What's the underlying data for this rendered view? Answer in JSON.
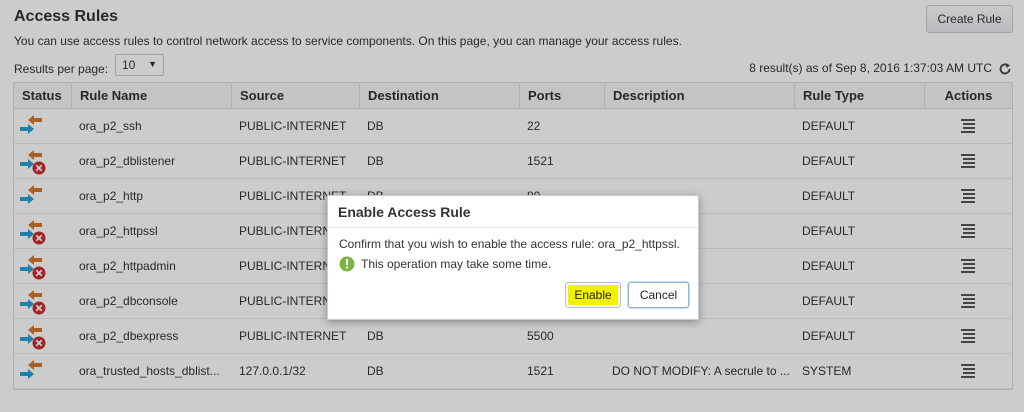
{
  "page": {
    "title": "Access Rules",
    "subtitle": "You can use access rules to control network access to service components. On this page, you can manage your access rules.",
    "create_button": "Create Rule"
  },
  "toolbar": {
    "results_per_page_label": "Results per page:",
    "results_per_page_value": "10",
    "results_info": "8 result(s) as of Sep 8, 2016 1:37:03 AM UTC"
  },
  "table": {
    "columns": [
      "Status",
      "Rule Name",
      "Source",
      "Destination",
      "Ports",
      "Description",
      "Rule Type",
      "Actions"
    ],
    "rows": [
      {
        "status": "enabled",
        "name": "ora_p2_ssh",
        "source": "PUBLIC-INTERNET",
        "destination": "DB",
        "ports": "22",
        "description": "",
        "type": "DEFAULT"
      },
      {
        "status": "disabled",
        "name": "ora_p2_dblistener",
        "source": "PUBLIC-INTERNET",
        "destination": "DB",
        "ports": "1521",
        "description": "",
        "type": "DEFAULT"
      },
      {
        "status": "enabled",
        "name": "ora_p2_http",
        "source": "PUBLIC-INTERNET",
        "destination": "DB",
        "ports": "80",
        "description": "",
        "type": "DEFAULT"
      },
      {
        "status": "disabled",
        "name": "ora_p2_httpssl",
        "source": "PUBLIC-INTERNET",
        "destination": "",
        "ports": "",
        "description": "",
        "type": "DEFAULT"
      },
      {
        "status": "disabled",
        "name": "ora_p2_httpadmin",
        "source": "PUBLIC-INTERNET",
        "destination": "",
        "ports": "",
        "description": "",
        "type": "DEFAULT"
      },
      {
        "status": "disabled",
        "name": "ora_p2_dbconsole",
        "source": "PUBLIC-INTERNET",
        "destination": "",
        "ports": "",
        "description": "",
        "type": "DEFAULT"
      },
      {
        "status": "disabled",
        "name": "ora_p2_dbexpress",
        "source": "PUBLIC-INTERNET",
        "destination": "DB",
        "ports": "5500",
        "description": "",
        "type": "DEFAULT"
      },
      {
        "status": "enabled",
        "name": "ora_trusted_hosts_dblist...",
        "source": "127.0.0.1/32",
        "destination": "DB",
        "ports": "1521",
        "description": "DO NOT MODIFY: A secrule to ...",
        "type": "SYSTEM"
      }
    ]
  },
  "dialog": {
    "title": "Enable Access Rule",
    "message": "Confirm that you wish to enable the access rule: ora_p2_httpssl.",
    "info": "This operation may take some time.",
    "enable_label": "Enable",
    "cancel_label": "Cancel"
  },
  "colors": {
    "enabled_arrow_in": "#2a9fd6",
    "enabled_arrow_out": "#d9772b",
    "disabled_x": "#cc2d2d",
    "ok_green": "#7cb342",
    "highlight": "#f2f200"
  },
  "icons": {
    "status_enabled": "rule-enabled-icon",
    "status_disabled": "rule-disabled-icon",
    "actions": "hamburger-menu-icon",
    "refresh": "refresh-icon",
    "info": "check-circle-icon"
  }
}
